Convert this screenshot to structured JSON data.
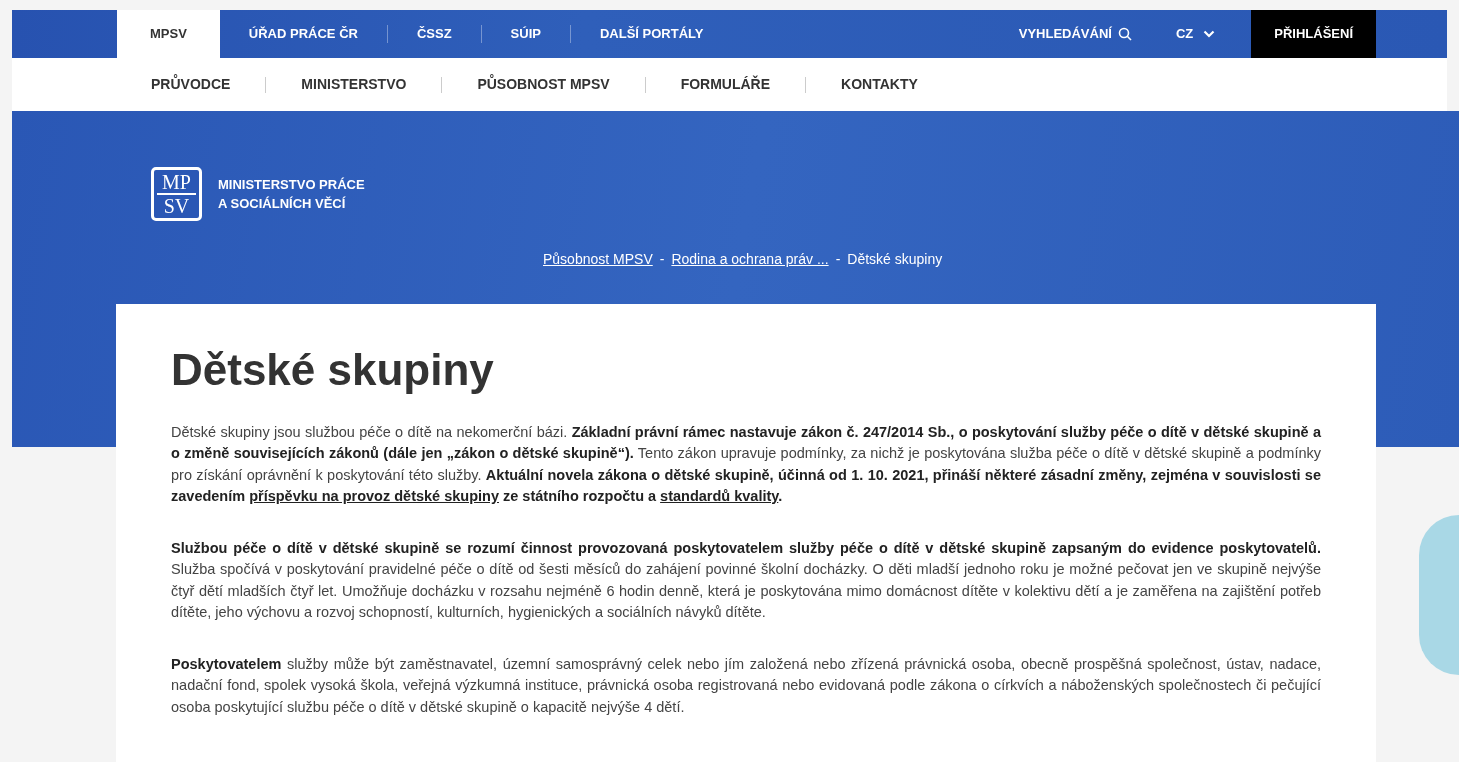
{
  "top_nav": {
    "tabs": [
      {
        "label": "MPSV",
        "selected": true
      },
      {
        "label": "ÚŘAD PRÁCE ČR",
        "selected": false
      },
      {
        "label": "ČSSZ",
        "selected": false
      },
      {
        "label": "SÚIP",
        "selected": false
      },
      {
        "label": "DALŠÍ PORTÁLY",
        "selected": false
      }
    ],
    "search_label": "VYHLEDÁVÁNÍ",
    "language": "CZ",
    "login": "PŘIHLÁŠENÍ"
  },
  "main_nav": [
    "PRŮVODCE",
    "MINISTERSTVO",
    "PŮSOBNOST MPSV",
    "FORMULÁŘE",
    "KONTAKTY"
  ],
  "logo": {
    "mark_top": "MP",
    "mark_bottom": "SV",
    "name_line_1": "MINISTERSTVO PRÁCE",
    "name_line_2": "A SOCIÁLNÍCH VĚCÍ"
  },
  "breadcrumb": [
    {
      "label": "Působnost MPSV",
      "link": true
    },
    {
      "label": "Rodina a ochrana práv ...",
      "link": true
    },
    {
      "label": "Dětské skupiny",
      "link": false
    }
  ],
  "breadcrumb_separator": "-",
  "title": "Dětské skupiny",
  "paragraphs": [
    [
      {
        "kind": "plain",
        "text": "Dětské skupiny jsou službou péče o dítě na nekomerční bázi. "
      },
      {
        "kind": "bold",
        "text": "Základní právní rámec nastavuje zákon č. 247/2014 Sb., o poskytování služby péče o dítě v dětské skupině a o změně souvisejících zákonů (dále jen „zákon o dětské skupině“)."
      },
      {
        "kind": "plain",
        "text": " Tento zákon upravuje podmínky, za nichž je poskytována služba péče o dítě v dětské skupině a podmínky pro získání oprávnění k poskytování této služby. "
      },
      {
        "kind": "bold",
        "text": "Aktuální novela zákona o dětské skupině, účinná od 1. 10. 2021, přináší některé zásadní změny, zejména v souvislosti se zavedením "
      },
      {
        "kind": "link",
        "text": "příspěvku na provoz dětské skupiny"
      },
      {
        "kind": "bold",
        "text": " ze státního rozpočtu a "
      },
      {
        "kind": "link",
        "text": "standardů kvality"
      },
      {
        "kind": "bold",
        "text": "."
      }
    ],
    [
      {
        "kind": "bold",
        "text": "Službou péče o dítě v dětské skupině se rozumí činnost provozovaná poskytovatelem služby péče o dítě v dětské skupině zapsaným do evidence poskytovatelů."
      },
      {
        "kind": "plain",
        "text": " Služba spočívá v poskytování pravidelné péče o dítě od šesti měsíců do zahájení povinné školní docházky. O děti mladší jednoho roku je možné pečovat jen ve skupině nejvýše čtyř dětí mladších čtyř let. Umožňuje docházku v rozsahu nejméně 6 hodin denně, která je poskytována mimo domácnost dítěte v kolektivu dětí a je zaměřena na zajištění potřeb dítěte, jeho výchovu a rozvoj schopností, kulturních, hygienických a sociálních návyků dítěte."
      }
    ],
    [
      {
        "kind": "bold",
        "text": "Poskytovatelem"
      },
      {
        "kind": "plain",
        "text": " služby může být zaměstnavatel, územní samosprávný celek nebo jím založená nebo zřízená právnická osoba, obecně prospěšná společnost, ústav, nadace, nadační fond, spolek vysoká škola, veřejná výzkumná instituce, právnická osoba registrovaná nebo evidovaná podle zákona o církvích a náboženských společnostech či pečující osoba poskytující službu péče o dítě v dětské skupině o kapacitě nejvýše 4 dětí."
      }
    ]
  ]
}
